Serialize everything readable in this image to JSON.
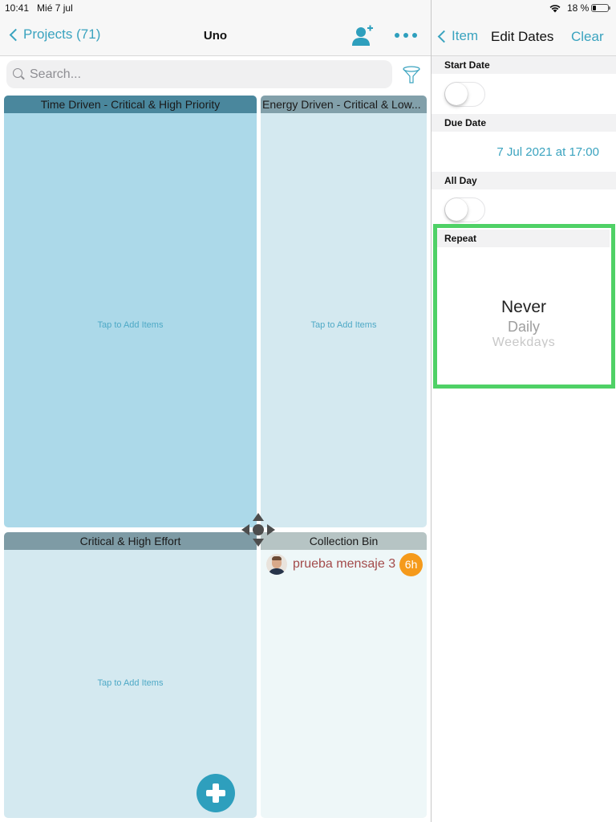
{
  "status_bar": {
    "time": "10:41",
    "date": "Mié 7 jul",
    "battery_percent": "18 %",
    "battery_level": 0.18
  },
  "left_nav": {
    "back_label": "Projects (71)",
    "title": "Uno",
    "icons": [
      "add-user-icon",
      "more-icon"
    ]
  },
  "search": {
    "placeholder": "Search...",
    "value": ""
  },
  "quadrants": [
    {
      "title": "Time Driven - Critical & High Priority",
      "hint": "Tap to Add Items",
      "color": "#acd9e9",
      "header_color": "#4a879d"
    },
    {
      "title": "Energy Driven - Critical & Low...",
      "hint": "Tap to Add Items",
      "color": "#d4e9f0",
      "header_color": "#82a0aa"
    },
    {
      "title": "Critical & High Effort",
      "hint": "Tap to Add Items",
      "color": "#d4e9f0",
      "header_color": "#7e9ba5"
    },
    {
      "title": "Collection Bin",
      "hint": "",
      "color": "#eef7f8",
      "header_color": "#b6c4c4",
      "items": [
        {
          "title": "prueba mensaje 3",
          "age_badge": "6h"
        }
      ]
    }
  ],
  "right_nav": {
    "back_label": "Item",
    "title": "Edit Dates",
    "clear_label": "Clear"
  },
  "edit_dates": {
    "start_date": {
      "label": "Start Date",
      "enabled": false
    },
    "due_date": {
      "label": "Due Date",
      "value": "7 Jul 2021 at 17:00"
    },
    "all_day": {
      "label": "All Day",
      "enabled": false
    },
    "repeat": {
      "label": "Repeat",
      "selected": "Never",
      "options": [
        "Never",
        "Daily",
        "Weekdays"
      ]
    }
  },
  "colors": {
    "accent": "#3aa3bf",
    "highlight": "#4fd166",
    "badge": "#f59a1b",
    "task_text": "#a34b4b"
  }
}
